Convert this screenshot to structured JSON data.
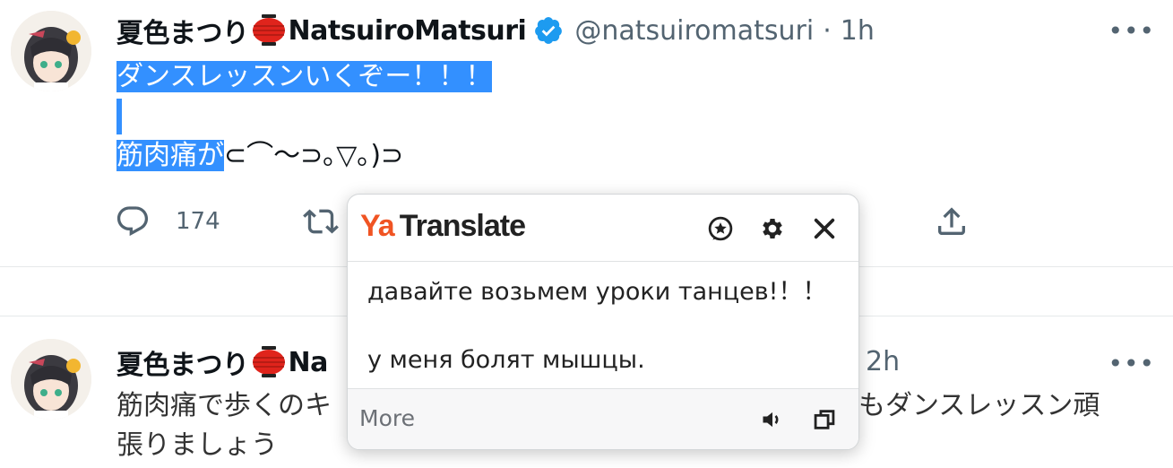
{
  "tweets": [
    {
      "author_name": "夏色まつり",
      "author_name_latin": "NatsuiroMatsuri",
      "handle": "@natsuiromatsuri",
      "separator": "·",
      "time": "1h",
      "text_line1": "ダンスレッスンいくぞー！！！",
      "text_line3_selected": "筋肉痛が",
      "text_line3_rest": "⊂⌒～⊃｡▽｡)⊃",
      "reply_count": "174"
    },
    {
      "author_name": "夏色まつり",
      "author_name_partial": "Na",
      "time": "2h",
      "text_line1_left": "筋肉痛で歩くのキ",
      "text_line1_right": "もダンスレッスン頑",
      "text_line2": "張りましょう"
    }
  ],
  "translate_popup": {
    "logo_ya": "Ya",
    "logo_translate": "Translate",
    "translation_text": "давайте возьмем уроки танцев!！！\n\nу меня болят мышцы.",
    "more_label": "More"
  },
  "icons": {
    "more": "more-horizontal-icon",
    "reply": "reply-icon",
    "retweet": "retweet-icon",
    "share": "share-icon",
    "verified": "verified-badge-icon",
    "lantern": "red-lantern-emoji",
    "popup_rate": "rate-star-icon",
    "popup_settings": "gear-icon",
    "popup_close": "close-icon",
    "speak": "speaker-icon",
    "copy": "copy-icon"
  },
  "colors": {
    "selection": "#3390ff",
    "verified": "#1d9bf0",
    "muted": "#536471",
    "yandex_orange": "#f05423"
  }
}
